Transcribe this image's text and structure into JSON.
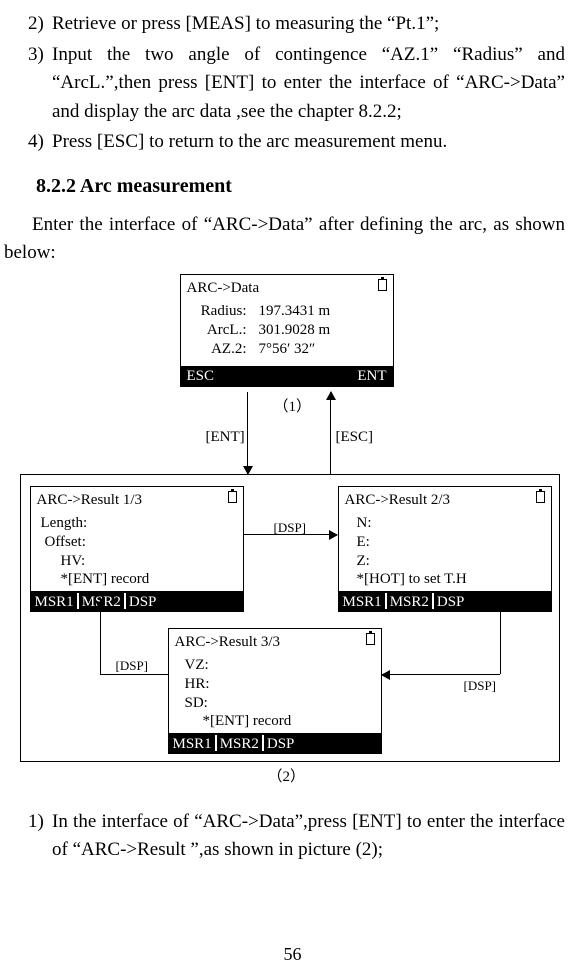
{
  "list": {
    "n2": "2)",
    "t2": "Retrieve or press [MEAS] to measuring the “Pt.1”;",
    "n3": "3)",
    "t3": "Input the two angle of contingence “AZ.1” “Radius” and “ArcL.”,then press [ENT] to enter the interface of “ARC->Data” and display the arc data ,see the chapter 8.2.2;",
    "n4": "4)",
    "t4": "Press [ESC] to return to the arc measurement menu."
  },
  "heading": "8.2.2 Arc measurement",
  "intro": "Enter the interface of “ARC->Data” after defining the arc, as shown below:",
  "screen1": {
    "title": "ARC->Data",
    "r1l": "Radius:",
    "r1v": "197.3431 m",
    "r2l": "ArcL.:",
    "r2v": "301.9028 m",
    "r3l": "AZ.2:",
    "r3v": "7°56′ 32″",
    "btnL": "ESC",
    "btnR": "ENT"
  },
  "screenA": {
    "title": "ARC->Result 1/3",
    "r1": "Length:",
    "r2": "Offset:",
    "r3": "HV:",
    "note": "*[ENT]  record",
    "b1": "MSR1",
    "b2": "MSR2",
    "b3": "DSP"
  },
  "screenB": {
    "title": "ARC->Result 2/3",
    "r1": "N:",
    "r2": "E:",
    "r3": "Z:",
    "note": "*[HOT] to set T.H",
    "b1": "MSR1",
    "b2": "MSR2",
    "b3": "DSP"
  },
  "screenC": {
    "title": "ARC->Result 3/3",
    "r1": "VZ:",
    "r2": "HR:",
    "r3": "SD:",
    "note": "*[ENT] record",
    "b1": "MSR1",
    "b2": "MSR2",
    "b3": "DSP"
  },
  "flow": {
    "cap1": "（1）",
    "cap2": "（2）",
    "ent": "[ENT]",
    "esc": "[ESC]",
    "dsp": "[DSP]"
  },
  "post": {
    "n1": "1)",
    "t1": "In the interface of “ARC->Data”,press [ENT] to enter the interface of “ARC->Result ”,as shown in picture (2);"
  },
  "page": "56"
}
